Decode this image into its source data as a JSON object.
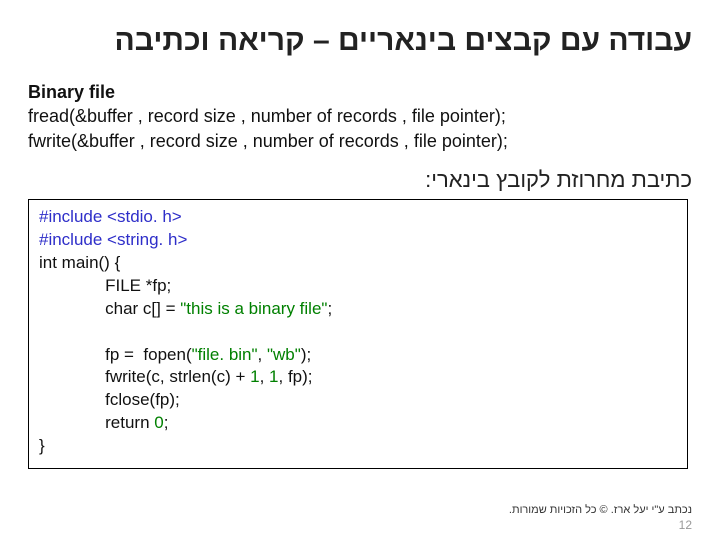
{
  "title": "עבודה עם קבצים בינאריים – קריאה וכתיבה",
  "desc": {
    "heading": "Binary file",
    "line1": "fread(&buffer ,  record size ,  number of records , file pointer);",
    "line2": "fwrite(&buffer ,  record size ,  number of records , file pointer);"
  },
  "subtitle": "כתיבת מחרוזת לקובץ בינארי:",
  "code": {
    "l1a": "#include",
    "l1b": " <stdio. h>",
    "l2a": "#include",
    "l2b": " <string. h>",
    "l3": "int main() {",
    "l4": "              FILE *fp;",
    "l5a": "              char ",
    "l5b": "c[]",
    "l5c": " = ",
    "l5d": "\"this is a binary file\"",
    "l5e": ";",
    "blank": "",
    "l6a": "              fp =  fopen(",
    "l6b": "\"file. bin\"",
    "l6c": ", ",
    "l6d": "\"wb\"",
    "l6e": ");",
    "l7a": "              fwrite(c, strlen(c) + ",
    "l7b": "1",
    "l7c": ", ",
    "l7d": "1",
    "l7e": ", fp);",
    "l8": "              fclose(fp);",
    "l9a": "              return ",
    "l9b": "0",
    "l9c": ";",
    "l10": "}"
  },
  "footer": {
    "credit": "נכתב ע\"י יעל ארז. © כל הזכויות שמורות.",
    "page": "12"
  }
}
